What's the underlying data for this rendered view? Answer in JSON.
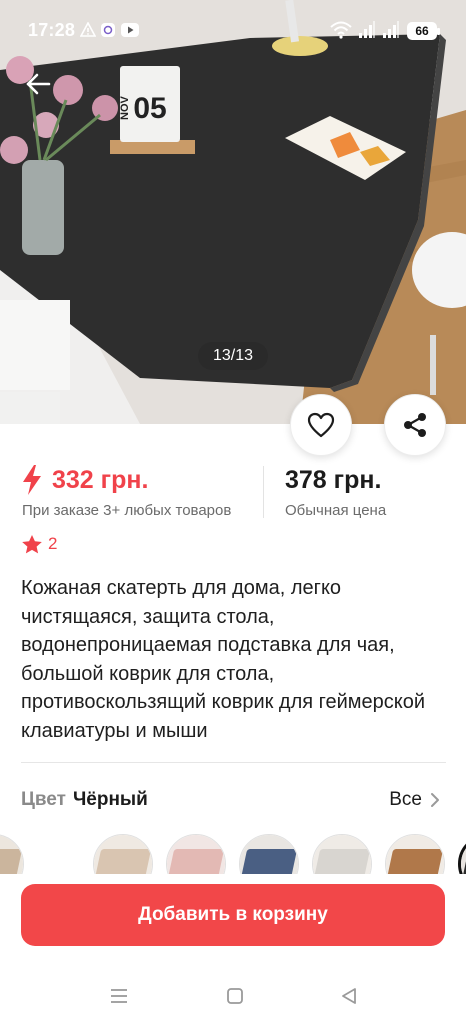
{
  "status_bar": {
    "time": "17:28",
    "battery": "66",
    "icons": [
      "warning-icon",
      "viber-icon",
      "youtube-icon",
      "wifi-icon",
      "signal-icon",
      "signal-icon",
      "battery-icon"
    ]
  },
  "gallery": {
    "counter": "13/13",
    "photo_text": {
      "month": "NOV",
      "day": "05"
    }
  },
  "price": {
    "promo": "332 грн.",
    "promo_note": "При заказе 3+ любых товаров",
    "regular": "378 грн.",
    "regular_note": "Обычная цена"
  },
  "rating": {
    "count": "2"
  },
  "product": {
    "title": "Кожаная скатерть для дома, легко чистящаяся, защита стола, водонепроницаемая подставка для чая, большой коврик для стола, противоскользящий коврик для геймерской клавиатуры и мыши"
  },
  "color": {
    "label": "Цвет",
    "value": "Чёрный",
    "all_link": "Все"
  },
  "swatches": [
    {
      "name": "beige",
      "wall": "#efe9e2",
      "mat": "#d9c5b1"
    },
    {
      "name": "pink",
      "wall": "#f1e6e4",
      "mat": "#e3b9b4"
    },
    {
      "name": "blue",
      "wall": "#e9e6e2",
      "mat": "#4a5f83"
    },
    {
      "name": "light-grey",
      "wall": "#efebe6",
      "mat": "#d8d5d0"
    },
    {
      "name": "brown",
      "wall": "#f0ebe5",
      "mat": "#b0784a"
    },
    {
      "name": "black",
      "wall": "#e8e4e0",
      "mat": "#2b2b2b",
      "selected": true
    }
  ],
  "actions": {
    "add_to_cart": "Добавить в корзину"
  },
  "colors": {
    "accent": "#f24749",
    "price_red": "#f0424a"
  }
}
